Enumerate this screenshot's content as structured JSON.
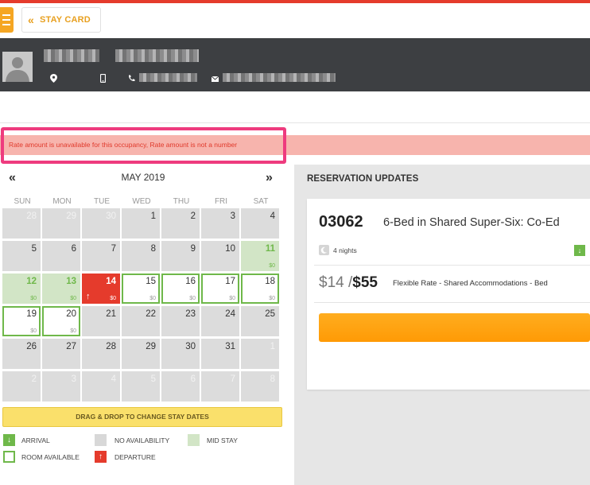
{
  "header": {
    "stay_card_label": "STAY CARD",
    "back_icon": "double-chevron-left-icon",
    "menu_icon": "hamburger-menu-icon"
  },
  "guest": {
    "name": "",
    "location": "",
    "phone": "",
    "email": "",
    "icons": [
      "location-pin-icon",
      "mobile-phone-icon",
      "phone-icon",
      "envelope-icon"
    ]
  },
  "error": {
    "message": "Rate amount is unavailable for this occupancy, Rate amount is not a number"
  },
  "calendar": {
    "prev_label": "«",
    "next_label": "»",
    "month_title": "MAY 2019",
    "weekdays": [
      "SUN",
      "MON",
      "TUE",
      "WED",
      "THU",
      "FRI",
      "SAT"
    ],
    "weeks": [
      [
        {
          "day": "28",
          "status": "faded",
          "price": ""
        },
        {
          "day": "29",
          "status": "faded",
          "price": ""
        },
        {
          "day": "30",
          "status": "faded",
          "price": ""
        },
        {
          "day": "1",
          "status": "none",
          "price": ""
        },
        {
          "day": "2",
          "status": "none",
          "price": ""
        },
        {
          "day": "3",
          "status": "none",
          "price": ""
        },
        {
          "day": "4",
          "status": "none",
          "price": ""
        }
      ],
      [
        {
          "day": "5",
          "status": "none",
          "price": ""
        },
        {
          "day": "6",
          "status": "none",
          "price": ""
        },
        {
          "day": "7",
          "status": "none",
          "price": ""
        },
        {
          "day": "8",
          "status": "none",
          "price": ""
        },
        {
          "day": "9",
          "status": "none",
          "price": ""
        },
        {
          "day": "10",
          "status": "none",
          "price": ""
        },
        {
          "day": "11",
          "status": "mid",
          "price": "$0"
        }
      ],
      [
        {
          "day": "12",
          "status": "mid",
          "price": "$0"
        },
        {
          "day": "13",
          "status": "mid",
          "price": "$0"
        },
        {
          "day": "14",
          "status": "departure",
          "price": "$0"
        },
        {
          "day": "15",
          "status": "available",
          "price": "$0"
        },
        {
          "day": "16",
          "status": "available",
          "price": "$0"
        },
        {
          "day": "17",
          "status": "available",
          "price": "$0"
        },
        {
          "day": "18",
          "status": "available",
          "price": "$0"
        }
      ],
      [
        {
          "day": "19",
          "status": "available",
          "price": "$0"
        },
        {
          "day": "20",
          "status": "available",
          "price": "$0"
        },
        {
          "day": "21",
          "status": "none",
          "price": ""
        },
        {
          "day": "22",
          "status": "none",
          "price": ""
        },
        {
          "day": "23",
          "status": "none",
          "price": ""
        },
        {
          "day": "24",
          "status": "none",
          "price": ""
        },
        {
          "day": "25",
          "status": "none",
          "price": ""
        }
      ],
      [
        {
          "day": "26",
          "status": "none",
          "price": ""
        },
        {
          "day": "27",
          "status": "none",
          "price": ""
        },
        {
          "day": "28",
          "status": "none",
          "price": ""
        },
        {
          "day": "29",
          "status": "none",
          "price": ""
        },
        {
          "day": "30",
          "status": "none",
          "price": ""
        },
        {
          "day": "31",
          "status": "none",
          "price": ""
        },
        {
          "day": "1",
          "status": "faded",
          "price": ""
        }
      ],
      [
        {
          "day": "2",
          "status": "faded",
          "price": ""
        },
        {
          "day": "3",
          "status": "faded",
          "price": ""
        },
        {
          "day": "4",
          "status": "faded",
          "price": ""
        },
        {
          "day": "5",
          "status": "faded",
          "price": ""
        },
        {
          "day": "6",
          "status": "faded",
          "price": ""
        },
        {
          "day": "7",
          "status": "faded",
          "price": ""
        },
        {
          "day": "8",
          "status": "faded",
          "price": ""
        }
      ]
    ],
    "drag_drop_label": "DRAG & DROP TO CHANGE STAY DATES"
  },
  "legend": {
    "arrival": "ARRIVAL",
    "no_availability": "NO AVAILABILITY",
    "mid_stay": "MID STAY",
    "room_available": "ROOM AVAILABLE",
    "departure": "DEPARTURE"
  },
  "reservation": {
    "panel_title": "RESERVATION UPDATES",
    "room_number": "03062",
    "room_type": "6-Bed in Shared Super-Six: Co-Ed",
    "nights": "4 nights",
    "old_rate": "$14",
    "separator": "/",
    "new_rate": "$55",
    "rate_description": "Flexible Rate - Shared Accommodations - Bed",
    "action_label": ""
  },
  "colors": {
    "accent_orange": "#ff9a05",
    "departure_red": "#e53b2c",
    "available_green": "#6fb84a",
    "mid_stay_green": "#d2e5c6",
    "error_bg": "#f7b4ad",
    "highlight_pink": "#ee3b7e",
    "header_dark": "#3d3f42"
  }
}
